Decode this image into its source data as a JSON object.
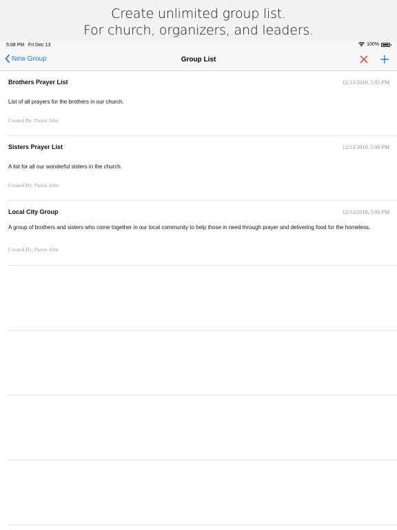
{
  "promo": {
    "line1": "Create unlimited group list.",
    "line2": "For church, organizers, and leaders."
  },
  "status_bar": {
    "time": "5:08 PM",
    "date": "Fri Dec 13",
    "battery": "100%",
    "battery_level": 1.0
  },
  "nav": {
    "back_label": "New Group",
    "title": "Group List"
  },
  "colors": {
    "accent": "#1a7ee8",
    "destructive": "#e0312b"
  },
  "icons": [
    "chevron-left-icon",
    "close-icon",
    "plus-icon",
    "wifi-icon",
    "battery-icon"
  ],
  "groups": [
    {
      "title": "Brothers Prayer List",
      "date": "12/13/2019, 5:05 PM",
      "description": "List of all prayers for the brothers in our church.",
      "created_by": "Created By: Pastor John"
    },
    {
      "title": "Sisters Prayer List",
      "date": "12/13/2019, 5:06 PM",
      "description": "A list for all our wonderful sisters in the church.",
      "created_by": "Created By: Pastor John"
    },
    {
      "title": "Local City Group",
      "date": "12/13/2019, 5:08 PM",
      "description": "A group of brothers and sisters who come together in our local community to help those in need through prayer and delivering food for the homeless.",
      "created_by": "Created By: Pastor John"
    }
  ]
}
